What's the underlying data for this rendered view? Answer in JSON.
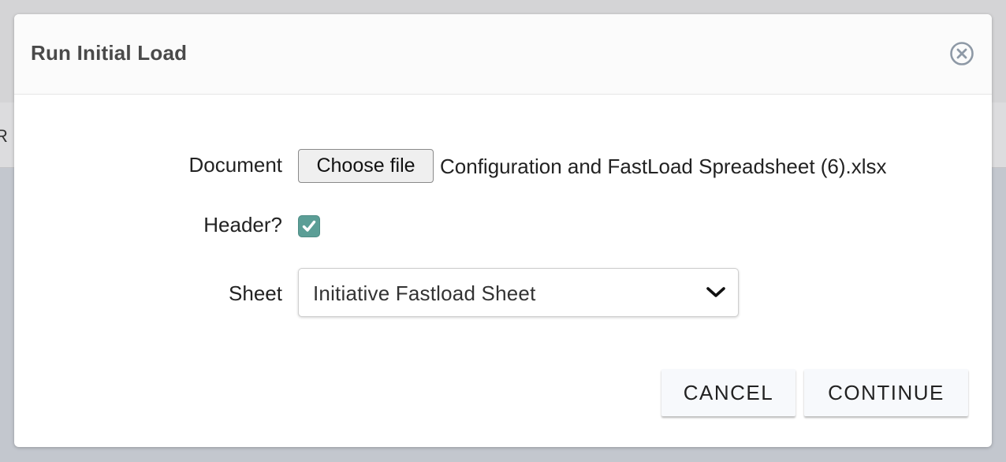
{
  "background": {
    "partial_text": "R"
  },
  "modal": {
    "title": "Run Initial Load",
    "close_icon": "close-circle-icon"
  },
  "form": {
    "document": {
      "label": "Document",
      "button_label": "Choose file",
      "file_name": "Configuration and FastLoad Spreadsheet (6).xlsx"
    },
    "header": {
      "label": "Header?",
      "checked": true,
      "icon": "checkmark-icon"
    },
    "sheet": {
      "label": "Sheet",
      "selected": "Initiative Fastload Sheet",
      "icon": "chevron-down-icon"
    }
  },
  "actions": {
    "cancel_label": "CANCEL",
    "continue_label": "CONTINUE"
  },
  "colors": {
    "checkbox_fill": "#5b9e96",
    "title_text": "#4a4a4a",
    "close_icon": "#8e99a6"
  }
}
